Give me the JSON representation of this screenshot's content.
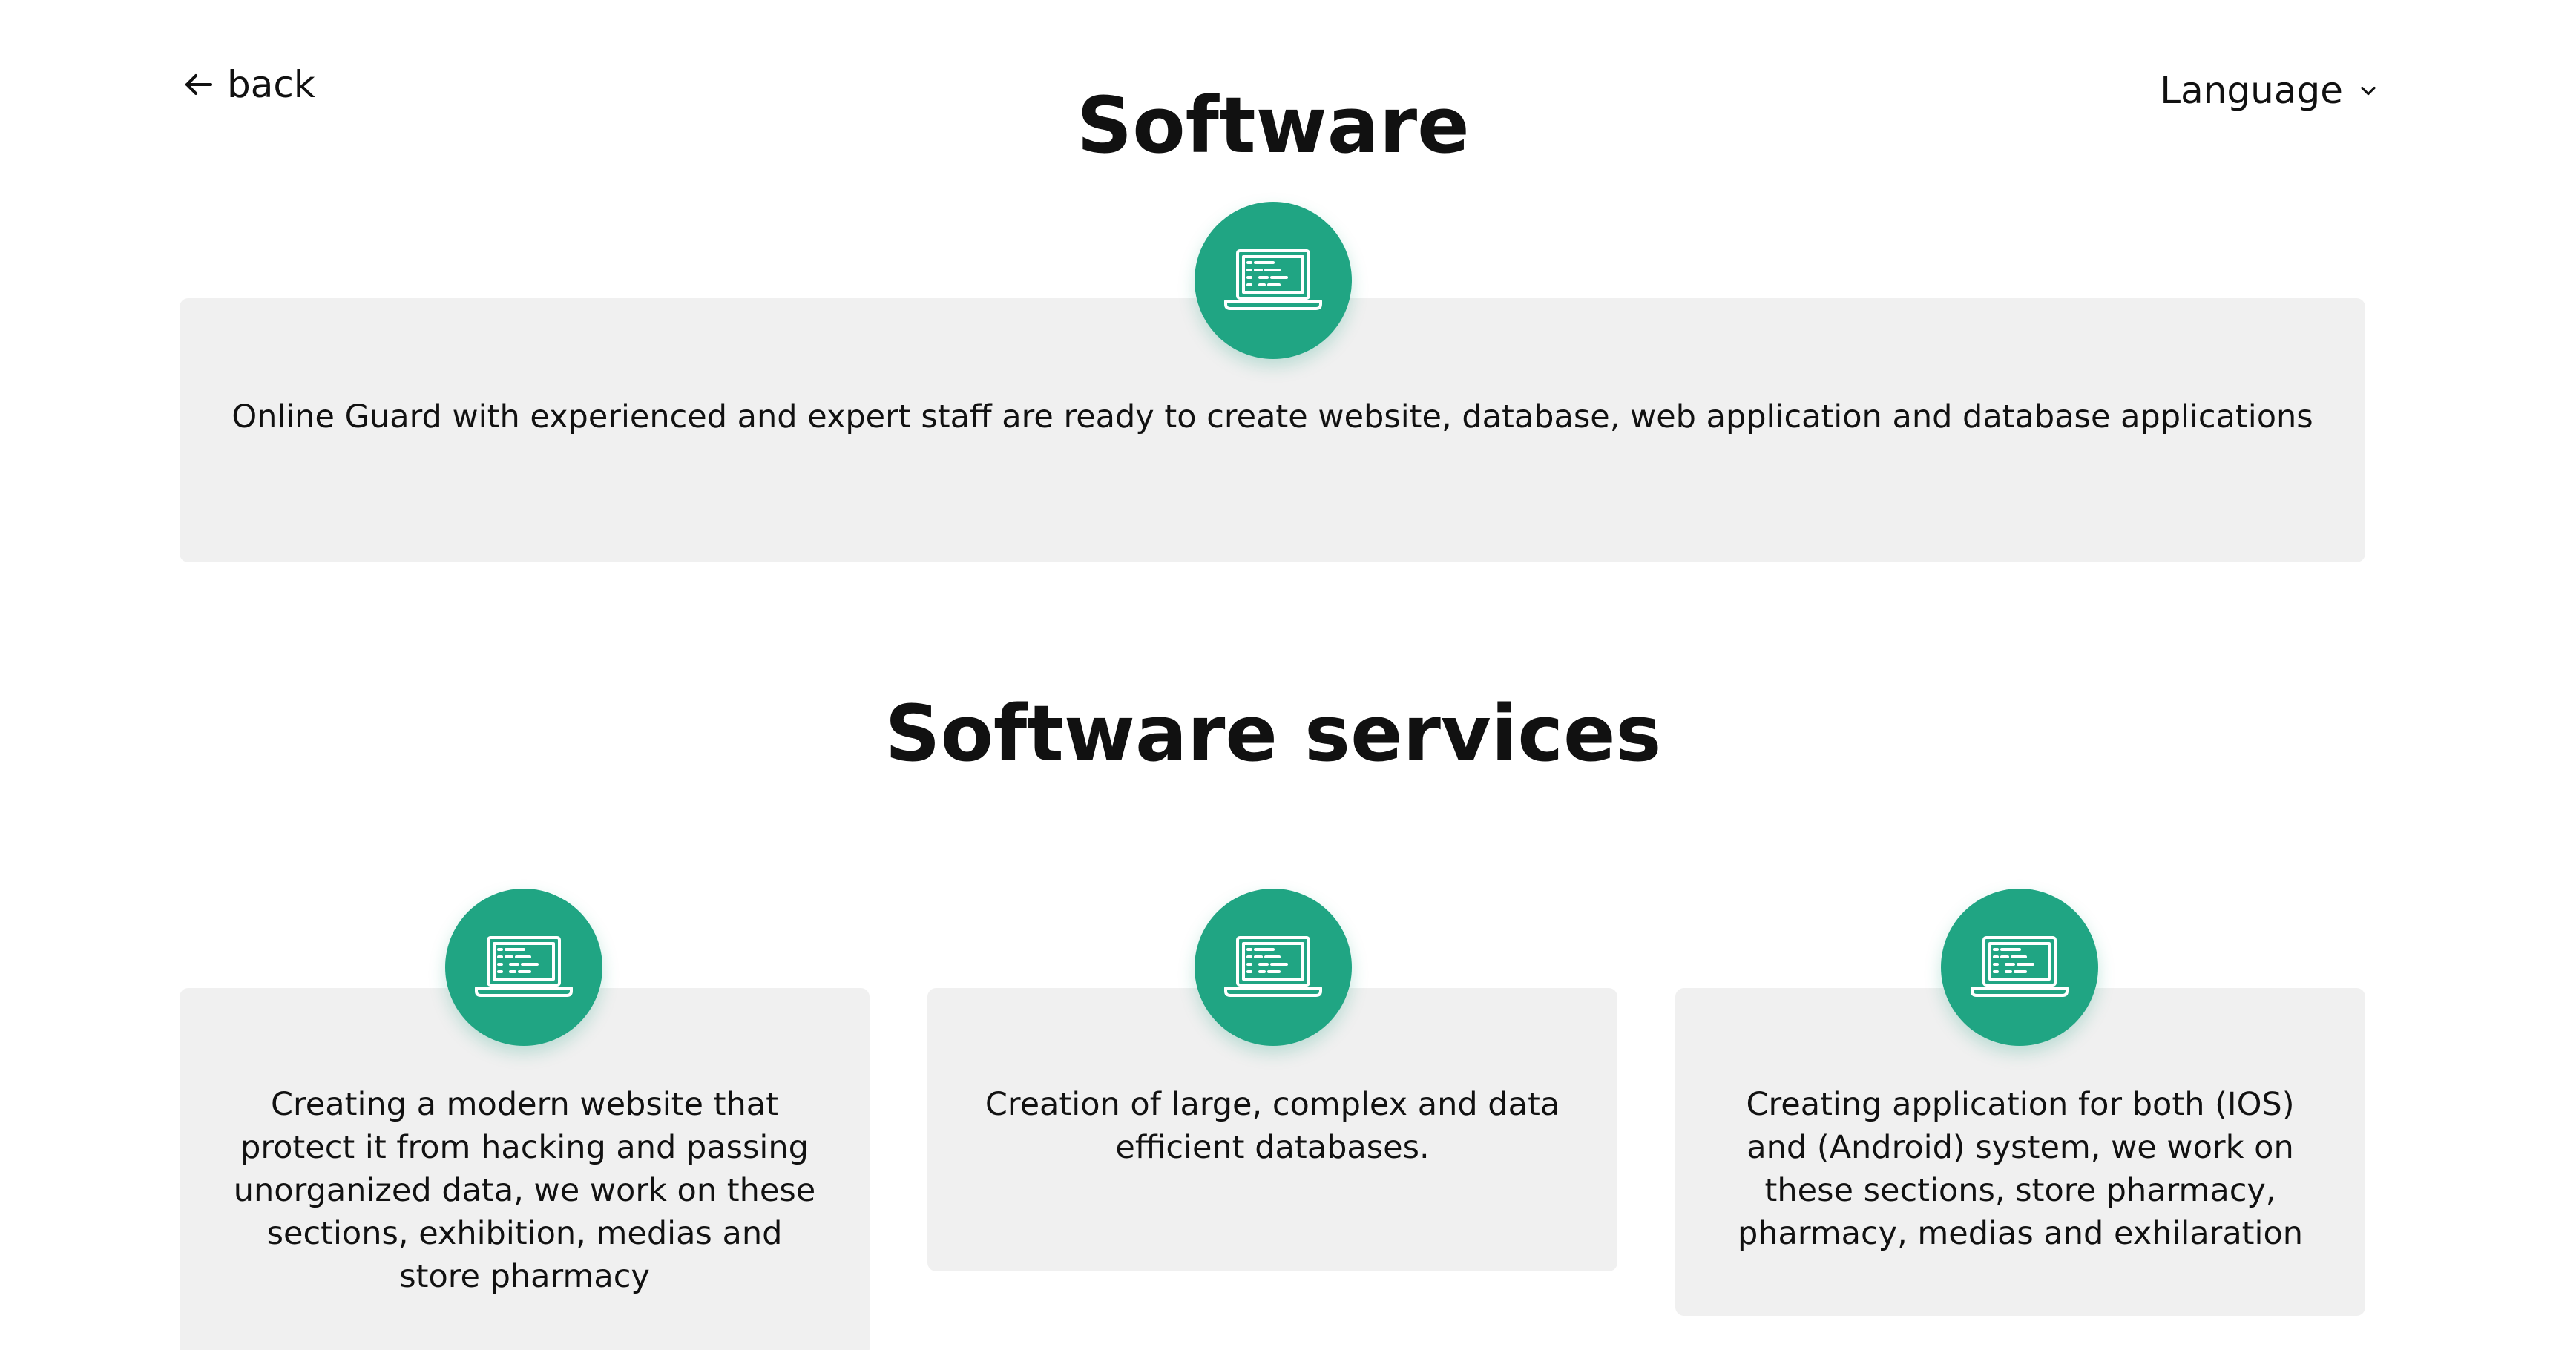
{
  "nav": {
    "back_label": "back",
    "language_label": "Language"
  },
  "header": {
    "title": "Software"
  },
  "intro": {
    "icon": "laptop-code-icon",
    "text": "Online Guard with experienced and expert staff are ready to create website, database, web application and database applications"
  },
  "services": {
    "title": "Software services",
    "items": [
      {
        "icon": "laptop-code-icon",
        "text": "Creating a modern website that protect it from hacking and passing unorganized data, we work on these sections, exhibition, medias and store pharmacy"
      },
      {
        "icon": "laptop-code-icon",
        "text": "Creation of large, complex and data efficient databases."
      },
      {
        "icon": "laptop-code-icon",
        "text": "Creating application for both (IOS) and (Android) system, we work on these sections, store pharmacy, pharmacy, medias and exhilaration"
      }
    ]
  },
  "colors": {
    "accent": "#20a583",
    "card_background": "#f0f0f0",
    "text": "#111111"
  }
}
